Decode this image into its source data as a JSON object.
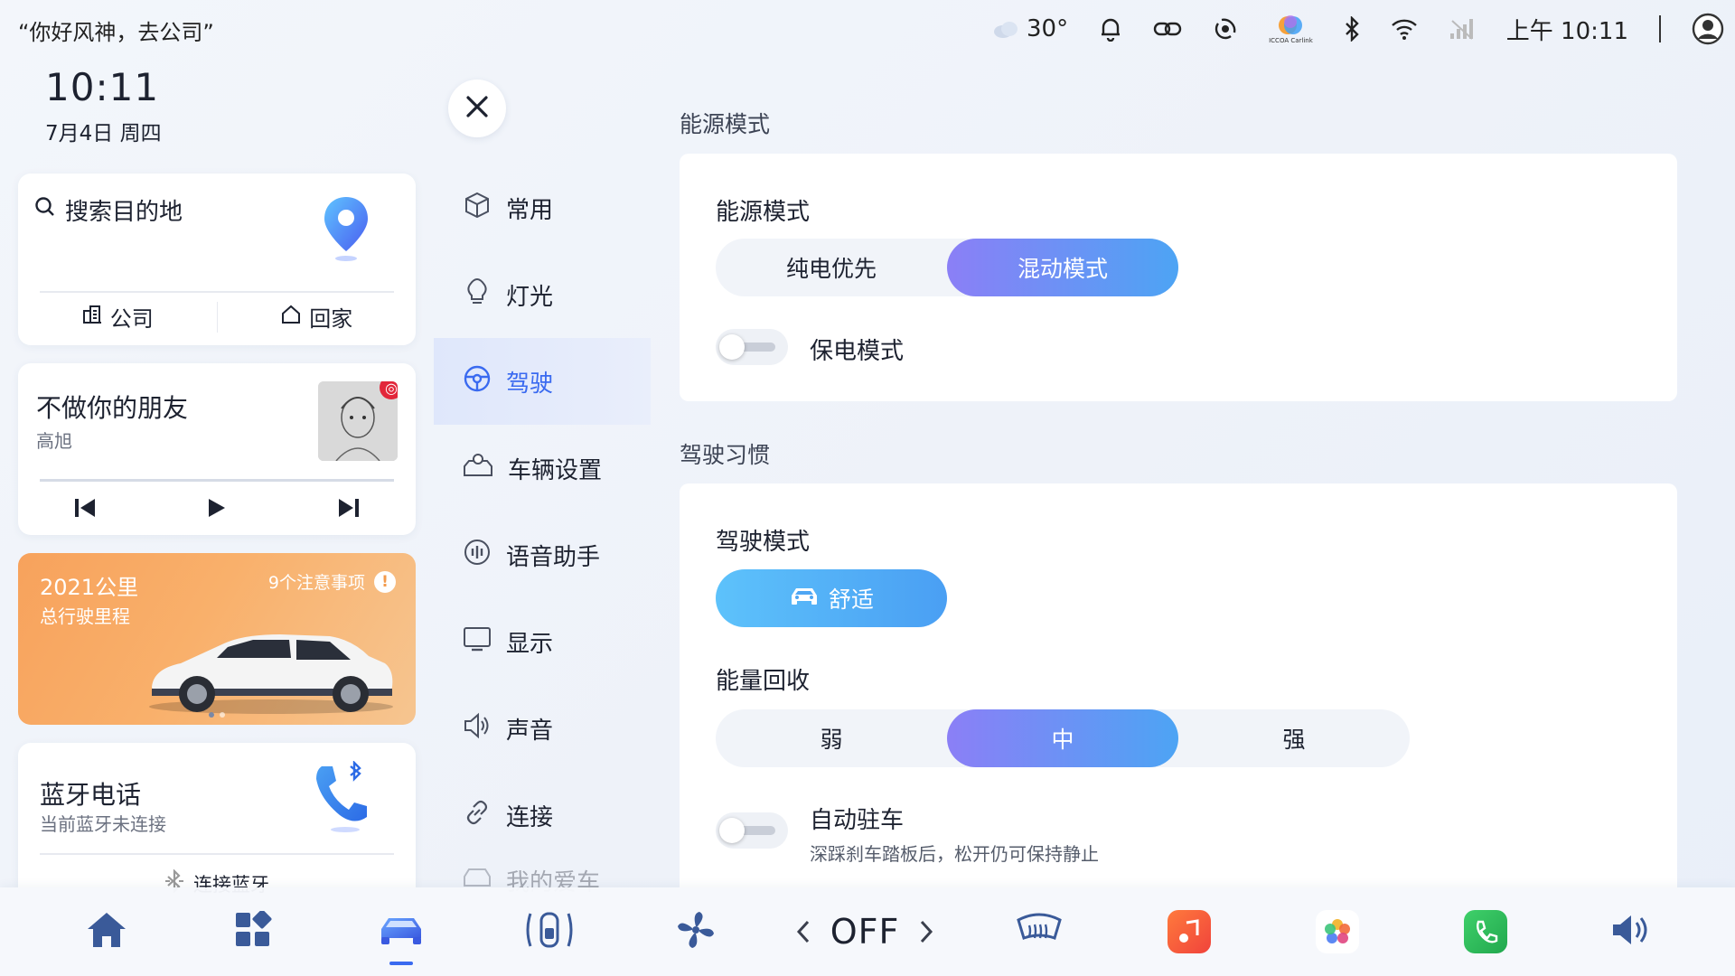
{
  "status_bar": {
    "voice_hint": "“你好风神，去公司”",
    "temperature": "30°",
    "time": "上午 10:11",
    "carlink_label": "ICCOA Carlink",
    "icons": [
      "cloud-icon",
      "bell-icon",
      "link-icon",
      "hotspot-icon",
      "carlink-icon",
      "bluetooth-icon",
      "wifi-icon",
      "signal-icon",
      "user-avatar-icon"
    ]
  },
  "clock": {
    "time": "10:11",
    "date": "7月4日 周四"
  },
  "nav_card": {
    "search_label": "搜索目的地",
    "company_label": "公司",
    "home_label": "回家"
  },
  "music_card": {
    "song": "不做你的朋友",
    "artist": "高旭"
  },
  "car_card": {
    "mileage": "2021公里",
    "mileage_label": "总行驶里程",
    "notice": "9个注意事项",
    "notice_icon": "!"
  },
  "bt_card": {
    "title": "蓝牙电话",
    "subtitle": "当前蓝牙未连接",
    "connect_label": "连接蓝牙"
  },
  "settings_nav": {
    "items": [
      {
        "label": "常用",
        "icon": "cube-icon"
      },
      {
        "label": "灯光",
        "icon": "bulb-icon"
      },
      {
        "label": "驾驶",
        "icon": "steering-wheel-icon"
      },
      {
        "label": "车辆设置",
        "icon": "car-settings-icon"
      },
      {
        "label": "语音助手",
        "icon": "voice-icon"
      },
      {
        "label": "显示",
        "icon": "monitor-icon"
      },
      {
        "label": "声音",
        "icon": "speaker-icon"
      },
      {
        "label": "连接",
        "icon": "link-icon"
      },
      {
        "label": "我的爱车",
        "icon": "car-icon"
      }
    ],
    "active_index": 2
  },
  "energy_section": {
    "section_title": "能源模式",
    "row_label": "能源模式",
    "options": [
      "纯电优先",
      "混动模式"
    ],
    "selected": "混动模式",
    "toggle_label": "保电模式",
    "toggle_on": false
  },
  "drive_section": {
    "section_title": "驾驶习惯",
    "mode_label": "驾驶模式",
    "mode_value": "舒适",
    "regen_label": "能量回收",
    "regen_options": [
      "弱",
      "中",
      "强"
    ],
    "regen_selected": "中",
    "autohold_label": "自动驻车",
    "autohold_desc": "深踩刹车踏板后，松开仍可保持静止",
    "autohold_on": false
  },
  "dock": {
    "fan_value": "OFF",
    "items": [
      "home-icon",
      "apps-icon",
      "car-icon",
      "seat-icon",
      "fan-icon",
      "fan-control",
      "defrost-icon",
      "music-app-icon",
      "photos-app-icon",
      "phone-app-icon",
      "volume-icon"
    ],
    "active": "car-icon"
  },
  "colors": {
    "accent_blue": "#3a6af0",
    "selected_gradient_start": "#8b7ff6",
    "selected_gradient_end": "#4da4f4",
    "orange_card": "#f7a25c"
  }
}
